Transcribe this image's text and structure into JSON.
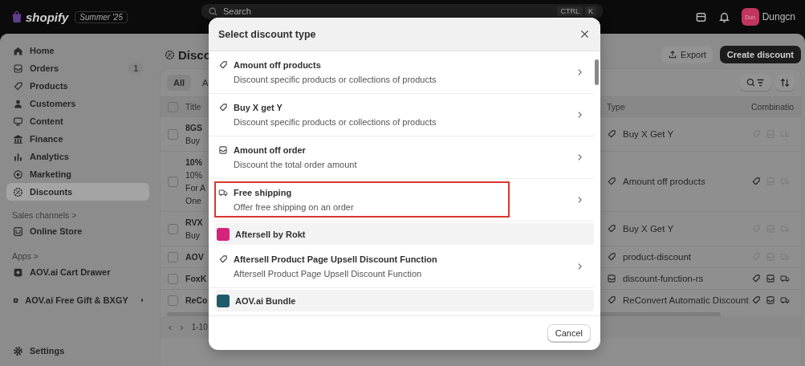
{
  "topbar": {
    "logo": "shopify",
    "edition": "Summer '25",
    "search": {
      "placeholder": "Search"
    },
    "shortcut_keys": [
      "CTRL",
      "K"
    ],
    "avatar": "Dun",
    "user": "Dungcn"
  },
  "sidebar": {
    "items": [
      {
        "label": "Home",
        "selected": false
      },
      {
        "label": "Orders",
        "selected": false,
        "badge": "1"
      },
      {
        "label": "Products",
        "selected": false
      },
      {
        "label": "Customers",
        "selected": false
      },
      {
        "label": "Content",
        "selected": false
      },
      {
        "label": "Finance",
        "selected": false
      },
      {
        "label": "Analytics",
        "selected": false
      },
      {
        "label": "Marketing",
        "selected": false
      },
      {
        "label": "Discounts",
        "selected": true
      }
    ],
    "sales_channels": {
      "heading": "Sales channels",
      "chevron": ">",
      "items": [
        {
          "label": "Online Store"
        }
      ]
    },
    "apps": {
      "heading": "Apps",
      "chevron": ">",
      "items": [
        {
          "label": "AOV.ai Cart Drawer",
          "dot": false
        },
        {
          "label": "AOV.ai Free Gift & BXGY",
          "dot": true
        }
      ]
    },
    "settings": "Settings"
  },
  "page": {
    "title": "Disco",
    "export": "Export",
    "create": "Create discount",
    "tabs": [
      {
        "label": "All",
        "selected": true
      },
      {
        "label": "A",
        "selected": false
      }
    ],
    "columns": {
      "title": "Title",
      "type": "Type",
      "combinations": "Combinatio"
    },
    "select_all_checked": false,
    "rows": [
      {
        "checked": false,
        "title_lines": [
          "8GS",
          "Buy"
        ],
        "type": "Buy X Get Y",
        "kind": "tag",
        "combinations": {
          "product": false,
          "order": false,
          "shipping": false
        }
      },
      {
        "checked": false,
        "title_lines": [
          "10%",
          "10%",
          "For A",
          "One"
        ],
        "type": "Amount off products",
        "kind": "tag",
        "combinations": {
          "product": true,
          "order": false,
          "shipping": false
        }
      },
      {
        "checked": false,
        "title_lines": [
          "RVX",
          "Buy"
        ],
        "type": "Buy X Get Y",
        "kind": "tag",
        "combinations": {
          "product": false,
          "order": false,
          "shipping": false
        }
      },
      {
        "checked": false,
        "title_lines": [
          "AOV"
        ],
        "type": "product-discount",
        "kind": "tag",
        "combinations": {
          "product": false,
          "order": false,
          "shipping": false
        }
      },
      {
        "checked": false,
        "title_lines": [
          "FoxK"
        ],
        "type": "discount-function-rs",
        "kind": "order",
        "combinations": {
          "product": true,
          "order": true,
          "shipping": true
        }
      },
      {
        "checked": false,
        "title_lines": [
          "ReCo"
        ],
        "type": "ReConvert Automatic Discount",
        "kind": "tag",
        "combinations": {
          "product": true,
          "order": true,
          "shipping": true
        }
      }
    ],
    "pager_arrows": [
      "‹",
      "›"
    ],
    "pagination": "1-10"
  },
  "modal": {
    "title": "Select discount type",
    "items": [
      {
        "kind": "tag",
        "title": "Amount off products",
        "description": "Discount specific products or collections of products",
        "highlighted": false
      },
      {
        "kind": "tag",
        "title": "Buy X get Y",
        "description": "Discount specific products or collections of products",
        "highlighted": false
      },
      {
        "kind": "order",
        "title": "Amount off order",
        "description": "Discount the total order amount",
        "highlighted": false
      },
      {
        "kind": "shipping",
        "title": "Free shipping",
        "description": "Offer free shipping on an order",
        "highlighted": true
      },
      {
        "kind": "app",
        "title": "Aftersell by Rokt",
        "color": "#d6247a"
      },
      {
        "kind": "tag",
        "title": "Aftersell Product Page Upsell Discount Function",
        "description": "Aftersell Product Page Upsell Discount Function",
        "highlighted": false
      },
      {
        "kind": "app",
        "title": "AOV.ai Bundle",
        "color": "#1f5a6b"
      }
    ],
    "cancel": "Cancel"
  }
}
